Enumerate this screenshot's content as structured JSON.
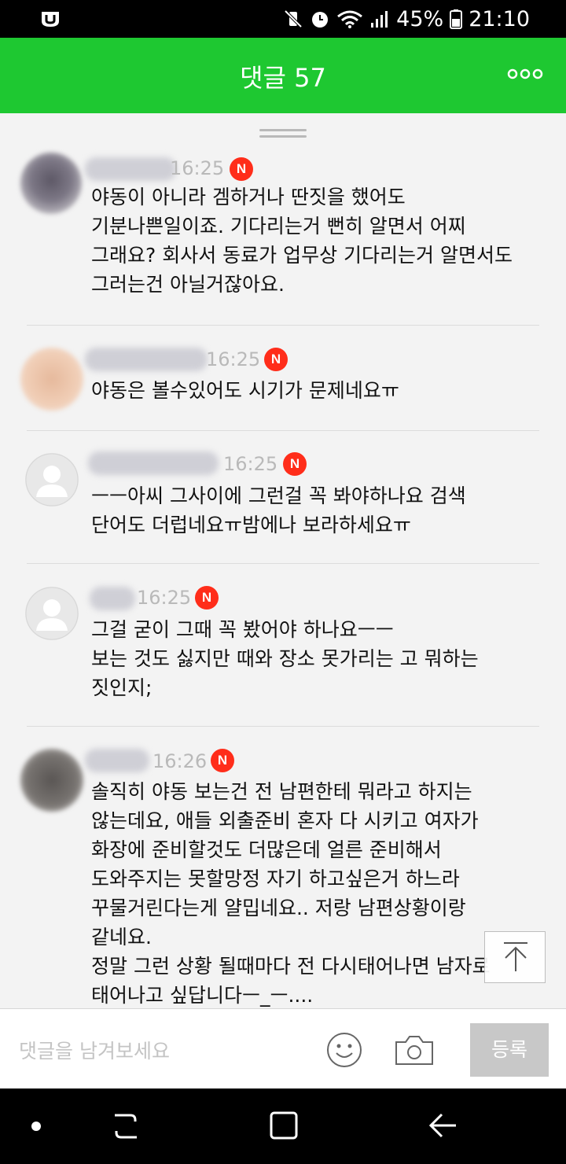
{
  "status_bar": {
    "battery": "45%",
    "time": "21:10"
  },
  "header": {
    "title": "댓글 57",
    "more_icon": "more-horizontal-icon"
  },
  "comments": [
    {
      "time": "16:25",
      "badge": "N",
      "text": "야동이 아니라 겜하거나 딴짓을 했어도\n기분나쁜일이죠. 기다리는거 뻔히 알면서 어찌\n그래요? 회사서 동료가 업무상 기다리는거 알면서도\n그러는건 아닐거잖아요."
    },
    {
      "time": "16:25",
      "badge": "N",
      "text": "야동은 볼수있어도 시기가 문제네요ㅠ"
    },
    {
      "time": "16:25",
      "badge": "N",
      "text": "ㅡㅡ아씨 그사이에 그런걸 꼭 봐야하나요 검색\n단어도 더럽네요ㅠ밤에나 보라하세요ㅠ"
    },
    {
      "time": "16:25",
      "badge": "N",
      "text": "그걸 굳이 그때 꼭 봤어야 하나요ㅡㅡ\n보는 것도 싫지만 때와 장소 못가리는 고 뭐하는\n짓인지;"
    },
    {
      "time": "16:26",
      "badge": "N",
      "text": "솔직히 야동 보는건 전 남편한테 뭐라고 하지는\n않는데요, 애들 외출준비 혼자 다 시키고 여자가\n화장에 준비할것도 더많은데 얼른 준비해서\n도와주지는 못할망정 자기 하고싶은거 하느라\n꾸물거린다는게 얄밉네요.. 저랑 남편상황이랑\n같네요.\n정말 그런 상황 될때마다 전 다시태어나면 남자로\n태어나고 싶답니다ㅡ_ㅡ...."
    }
  ],
  "input": {
    "placeholder": "댓글을 남겨보세요",
    "submit_label": "등록"
  }
}
